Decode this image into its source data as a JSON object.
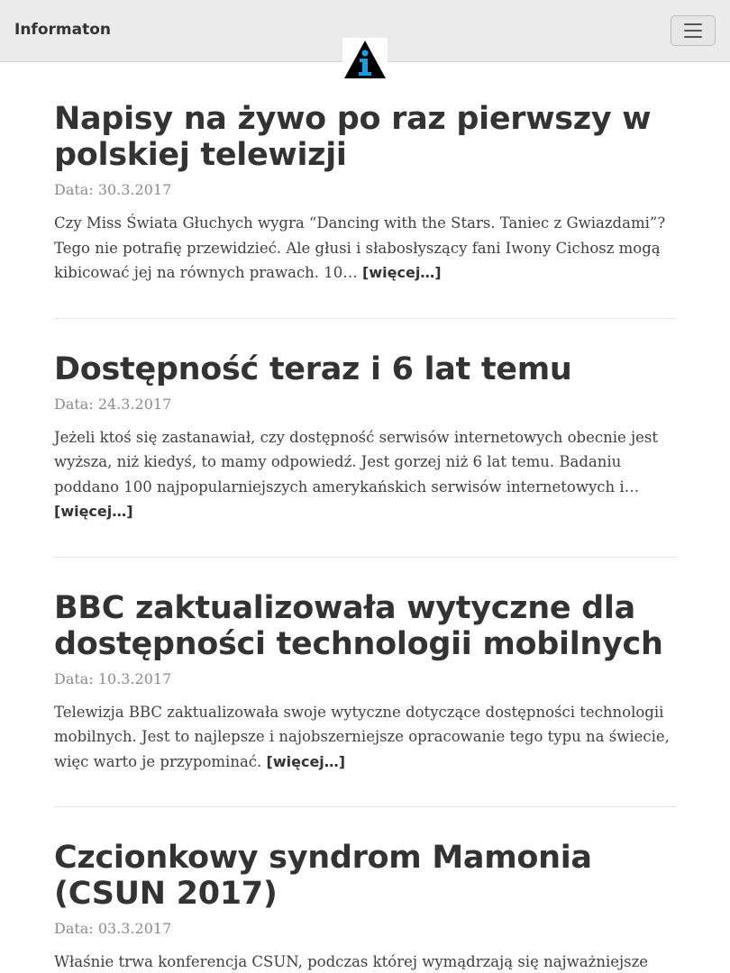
{
  "navbar": {
    "brand": "Informaton",
    "menu_icon": "hamburger-menu-icon",
    "logo_icon": "information-logo-icon"
  },
  "colors": {
    "navbar_bg": "#ebebeb",
    "logo_triangle": "#000000",
    "logo_i": "#1e9be0",
    "text": "#333333",
    "date": "#8c8c8c"
  },
  "posts": [
    {
      "title": "Napisy na żywo po raz pierwszy w polskiej telewizji",
      "date": "Data: 30.3.2017",
      "excerpt": "Czy Miss Świata Głuchych wygra “Dancing with the Stars. Taniec z Gwiazdami”? Tego nie potrafię przewidzieć. Ale głusi i słabosłyszący fani Iwony Cichosz mogą kibicować jej na równych prawach. 10…",
      "more": "[więcej…]"
    },
    {
      "title": "Dostępność teraz i 6 lat temu",
      "date": "Data: 24.3.2017",
      "excerpt": "Jeżeli ktoś się zastanawiał, czy dostępność serwisów internetowych obecnie jest wyższa, niż kiedyś, to mamy odpowiedź. Jest gorzej niż 6 lat temu. Badaniu poddano 100 najpopularniejszych amerykańskich serwisów internetowych i…",
      "more": "[więcej…]"
    },
    {
      "title": "BBC zaktualizowała wytyczne dla dostępności technologii mobilnych",
      "date": "Data: 10.3.2017",
      "excerpt": "Telewizja BBC zaktualizowała swoje wytyczne dotyczące dostępności technologii mobilnych. Jest to najlepsze i najobszerniejsze opracowanie tego typu na świecie, więc warto je przypominać.",
      "more": "[więcej…]"
    },
    {
      "title": "Czcionkowy syndrom Mamonia (CSUN 2017)",
      "date": "Data: 03.3.2017",
      "excerpt": "Właśnie trwa konferencja CSUN, podczas której wymądrzają się najważniejsze",
      "more": ""
    }
  ]
}
